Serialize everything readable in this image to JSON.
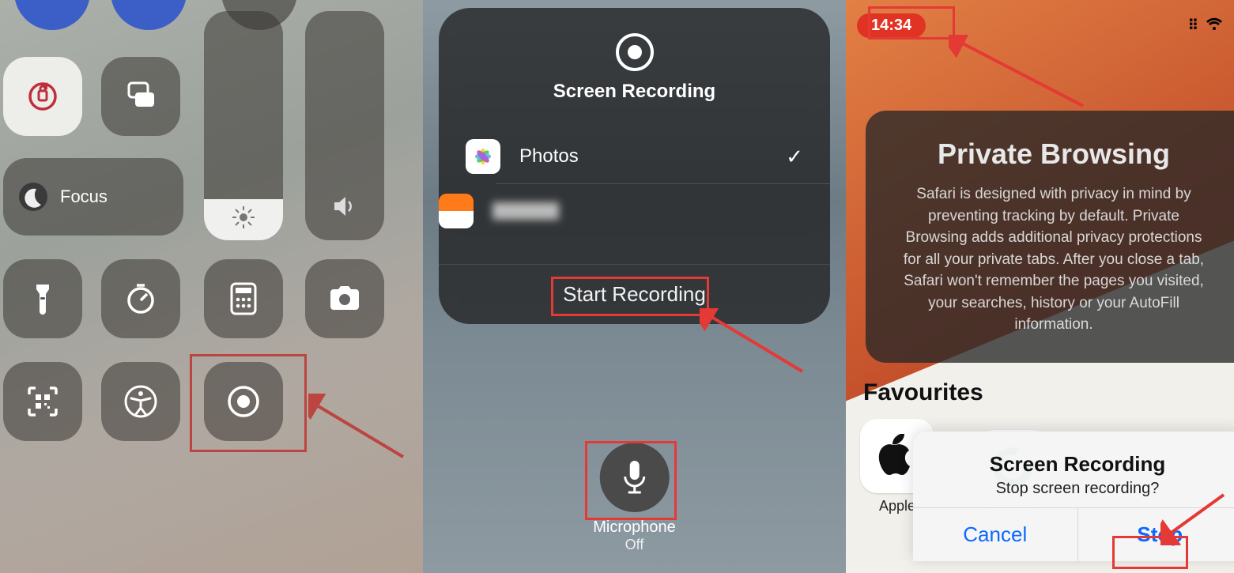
{
  "panel1": {
    "focus_label": "Focus"
  },
  "panel2": {
    "title": "Screen Recording",
    "apps": [
      {
        "name": "Photos",
        "selected": true
      },
      {
        "name": "",
        "selected": false
      }
    ],
    "start_label": "Start Recording",
    "mic_label": "Microphone",
    "mic_state": "Off"
  },
  "panel3": {
    "time": "14:34",
    "pb_title": "Private Browsing",
    "pb_body": "Safari is designed with privacy in mind by preventing tracking by default. Private Browsing adds additional privacy protections for all your private tabs. After you close a tab, Safari won't remember the pages you visited, your searches, history or your AutoFill information.",
    "favourites_label": "Favourites",
    "fav_app": "Apple",
    "alert_title": "Screen Recording",
    "alert_msg": "Stop screen recording?",
    "cancel_label": "Cancel",
    "stop_label": "Stop"
  }
}
